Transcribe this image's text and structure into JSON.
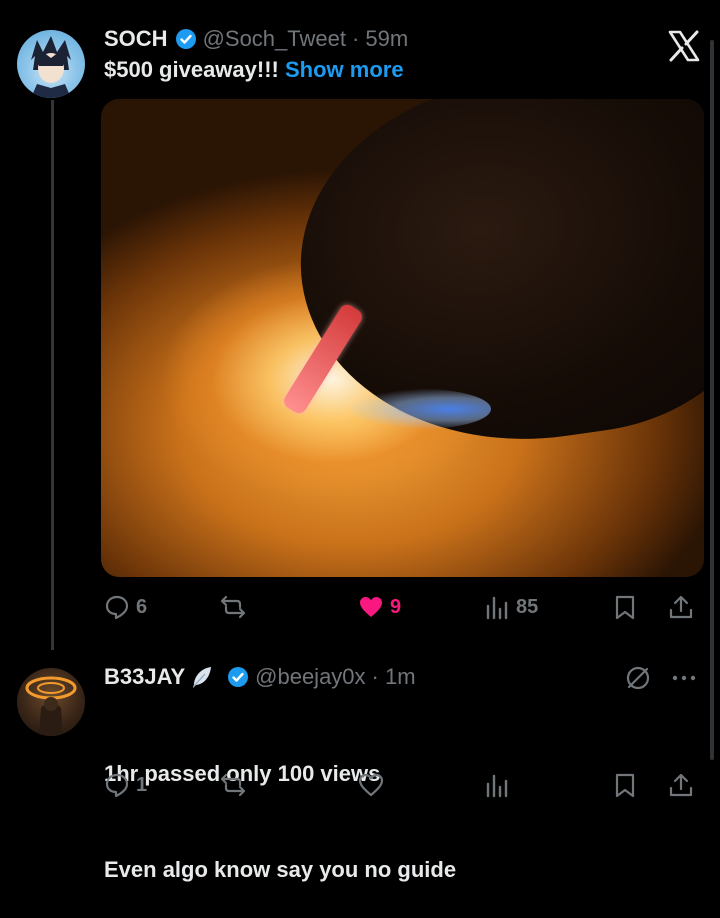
{
  "tweet": {
    "display_name": "SOCH",
    "handle": "@Soch_Tweet",
    "time": "· 59m",
    "text": "$500 giveaway!!! ",
    "show_more": "Show more",
    "actions": {
      "replies": "6",
      "reposts": "",
      "likes": "9",
      "views": "85"
    }
  },
  "reply": {
    "display_name": "B33JAY",
    "handle": "@beejay0x",
    "time": "· 1m",
    "line1": "1hr passed only 100 views",
    "line2": "Even algo know say you no guide",
    "actions": {
      "replies": "1"
    }
  },
  "colors": {
    "background": "#000000",
    "text": "#e7e9ea",
    "muted": "#71767b",
    "accent": "#1d9bf0",
    "like": "#f91880"
  },
  "icons": [
    "x-logo-icon",
    "verified-badge-icon",
    "reply-icon",
    "repost-icon",
    "like-icon",
    "views-icon",
    "bookmark-icon",
    "share-icon",
    "grok-icon",
    "more-icon"
  ]
}
